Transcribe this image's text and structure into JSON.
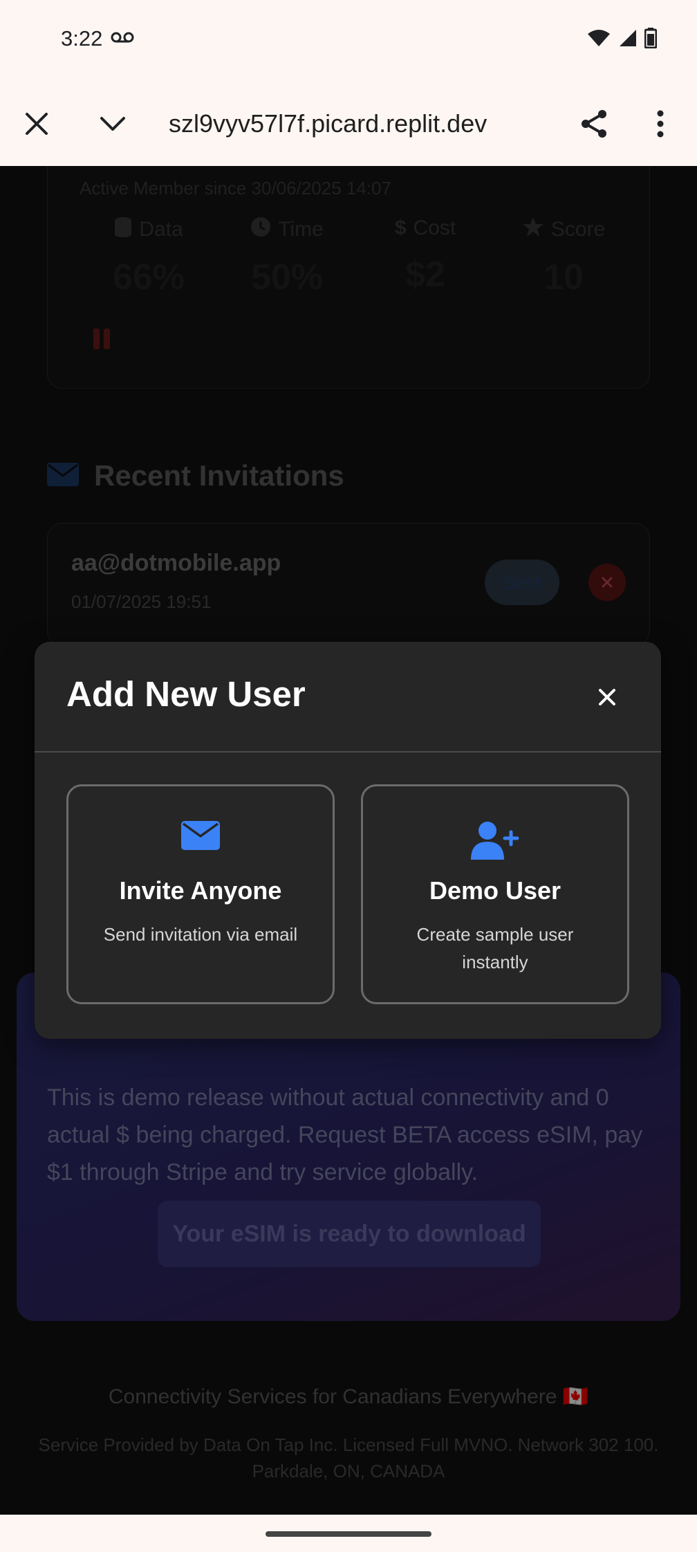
{
  "status_bar": {
    "time": "3:22"
  },
  "browser": {
    "url": "szl9vyv57l7f.picard.replit.dev"
  },
  "member_card": {
    "member_since": "Active Member since 30/06/2025 14:07",
    "stats": [
      {
        "label": "Data",
        "value": "66%",
        "icon": "database-icon"
      },
      {
        "label": "Time",
        "value": "50%",
        "icon": "clock-icon"
      },
      {
        "label": "Cost",
        "value": "$2",
        "icon": "dollar-icon"
      },
      {
        "label": "Score",
        "value": "10",
        "icon": "star-icon"
      }
    ]
  },
  "invitations": {
    "title": "Recent Invitations",
    "items": [
      {
        "email": "aa@dotmobile.app",
        "date": "01/07/2025 19:51",
        "status": "Sent"
      }
    ]
  },
  "modal": {
    "title": "Add New User",
    "options": [
      {
        "title": "Invite Anyone",
        "description": "Send invitation via email",
        "icon": "envelope-icon"
      },
      {
        "title": "Demo User",
        "description": "Create sample user instantly",
        "icon": "user-plus-icon"
      }
    ]
  },
  "promo": {
    "text": "This is demo release without actual connectivity and 0 actual $ being charged. Request BETA access eSIM, pay $1 through Stripe and try service globally.",
    "button_label": "Your eSIM is ready to download"
  },
  "footer": {
    "tagline": "Connectivity Services for Canadians Everywhere 🇨🇦",
    "legal": "Service Provided by Data On Tap Inc. Licensed Full MVNO. Network 302 100. Parkdale, ON, CANADA"
  },
  "colors": {
    "accent_blue": "#3b82f6",
    "modal_bg": "#262626",
    "page_bg": "#121212"
  }
}
